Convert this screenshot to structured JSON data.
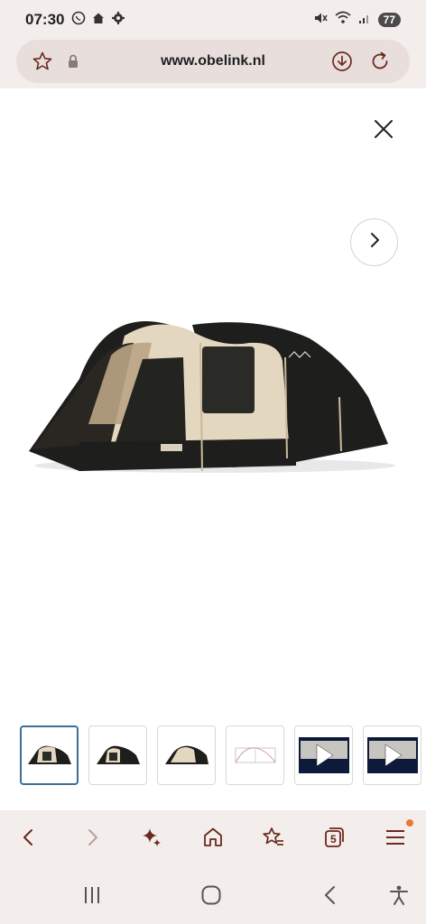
{
  "status": {
    "time": "07:30",
    "battery": "77",
    "left_icons": [
      "whatsapp-icon",
      "home-icon",
      "settings-icon"
    ],
    "right_icons": [
      "mute-icon",
      "wifi-icon",
      "signal-icon"
    ]
  },
  "browser": {
    "url": "www.obelink.nl",
    "tab_count": "5"
  },
  "gallery": {
    "thumbnails": [
      {
        "kind": "image",
        "active": true
      },
      {
        "kind": "image",
        "active": false
      },
      {
        "kind": "image",
        "active": false
      },
      {
        "kind": "diagram",
        "active": false
      },
      {
        "kind": "video",
        "active": false
      },
      {
        "kind": "video",
        "active": false
      }
    ]
  },
  "colors": {
    "accent": "#3e6f96",
    "toolbar_icon": "#6a2a1c",
    "notification_dot": "#e87a30",
    "tent_dark": "#1e1e1c",
    "tent_beige": "#e4d7c0"
  }
}
